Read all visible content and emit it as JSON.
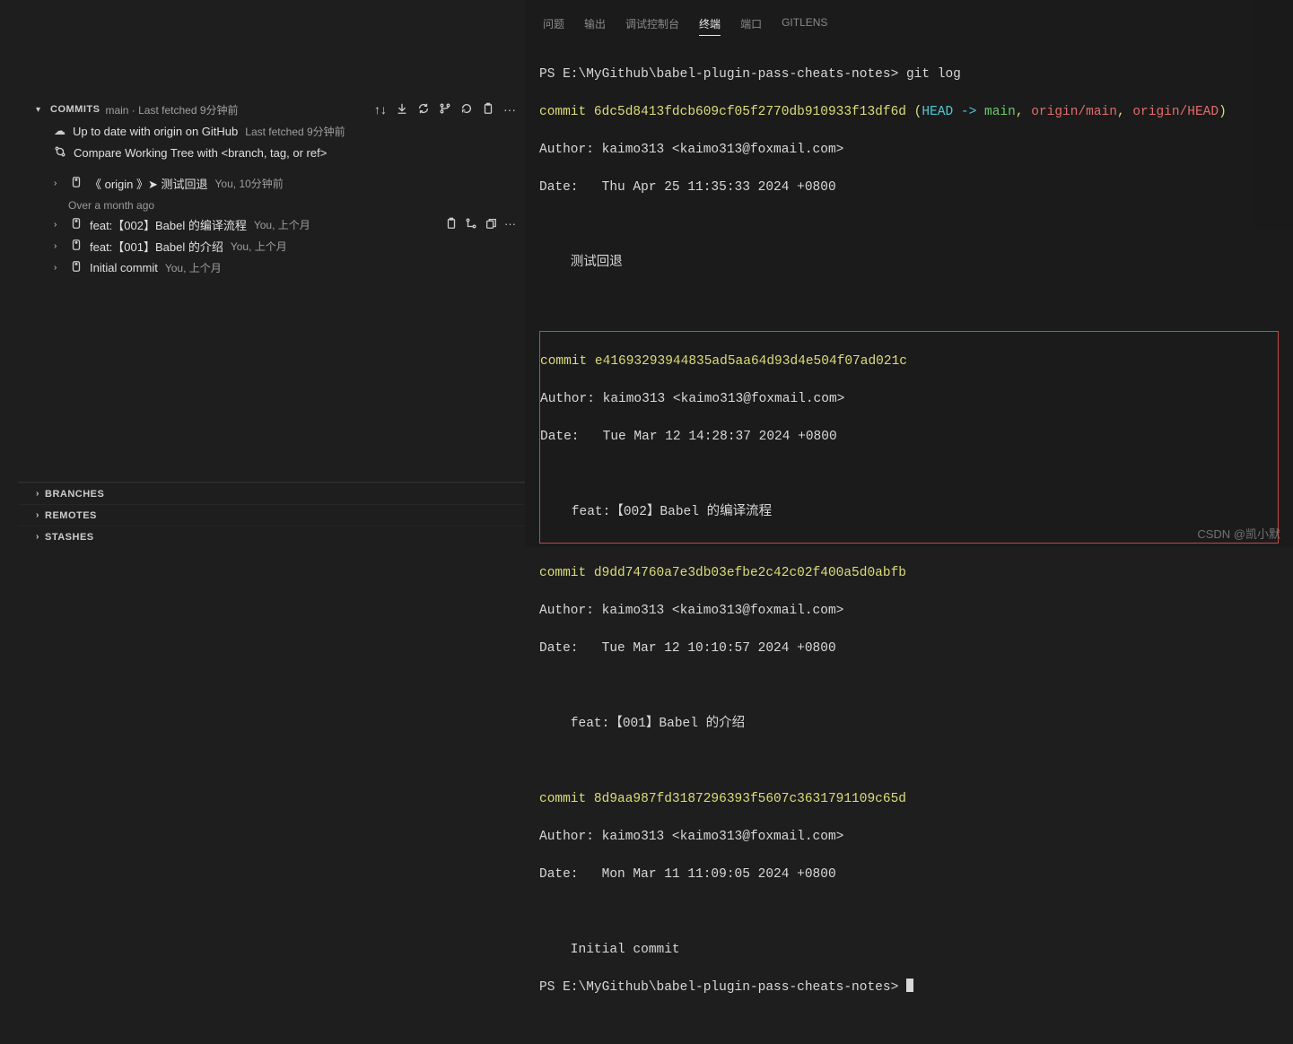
{
  "sidebar": {
    "commits_title": "COMMITS",
    "commits_subtitle": "main · Last fetched 9分钟前",
    "uptodate": "Up to date with origin on GitHub",
    "uptodate_meta": "Last fetched 9分钟前",
    "compare": "Compare Working Tree with <branch, tag, or ref>",
    "origin_row": "《 origin 》➤  测试回退",
    "origin_meta": "You, 10分钟前",
    "group_label": "Over a month ago",
    "commits": [
      {
        "label": "feat:【002】Babel 的编译流程",
        "meta": "You, 上个月",
        "has_actions": true
      },
      {
        "label": "feat:【001】Babel 的介绍",
        "meta": "You, 上个月",
        "has_actions": false
      },
      {
        "label": "Initial commit",
        "meta": "You, 上个月",
        "has_actions": false
      }
    ],
    "bottom": [
      "BRANCHES",
      "REMOTES",
      "STASHES"
    ]
  },
  "tabs": {
    "items": [
      "问题",
      "输出",
      "调试控制台",
      "终端",
      "端口",
      "GITLENS"
    ],
    "active_index": 3
  },
  "terminal": {
    "prompt1": "PS E:\\MyGithub\\babel-plugin-pass-cheats-notes> git log",
    "c1_line": "commit 6dc5d8413fdcb609cf05f2770db910933f13df6d",
    "c1_refs": {
      "open": " (",
      "head": "HEAD -> ",
      "main": "main",
      "sep1": ", ",
      "om": "origin/main",
      "sep2": ", ",
      "oh": "origin/HEAD",
      "close": ")"
    },
    "c1_author": "Author: kaimo313 <kaimo313@foxmail.com>",
    "c1_date": "Date:   Thu Apr 25 11:35:33 2024 +0800",
    "c1_msg": "    测试回退",
    "c2_line": "commit e41693293944835ad5aa64d93d4e504f07ad021c",
    "c2_author": "Author: kaimo313 <kaimo313@foxmail.com>",
    "c2_date": "Date:   Tue Mar 12 14:28:37 2024 +0800",
    "c2_msg": "    feat:【002】Babel 的编译流程",
    "c3_line": "commit d9dd74760a7e3db03efbe2c42c02f400a5d0abfb",
    "c3_author": "Author: kaimo313 <kaimo313@foxmail.com>",
    "c3_date": "Date:   Tue Mar 12 10:10:57 2024 +0800",
    "c3_msg": "    feat:【001】Babel 的介绍",
    "c4_line": "commit 8d9aa987fd3187296393f5607c3631791109c65d",
    "c4_author": "Author: kaimo313 <kaimo313@foxmail.com>",
    "c4_date": "Date:   Mon Mar 11 11:09:05 2024 +0800",
    "c4_msg": "    Initial commit",
    "prompt2": "PS E:\\MyGithub\\babel-plugin-pass-cheats-notes> "
  },
  "watermark": "CSDN @凯小默"
}
